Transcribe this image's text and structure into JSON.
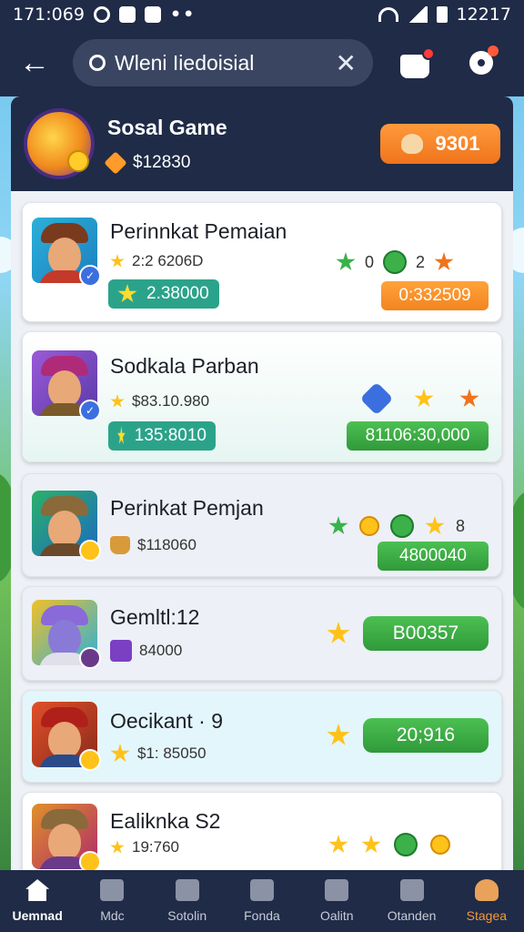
{
  "status_bar": {
    "time": "171:069",
    "right_text": "12217"
  },
  "top_bar": {
    "search_placeholder": "Wleni Iiedoisial",
    "clear_glyph": "✕",
    "back_glyph": "←"
  },
  "header": {
    "title": "Sosal Game",
    "balance": "$12830",
    "button_label": "9301"
  },
  "cards": [
    {
      "title": "Perinnkat Pemaian",
      "sub": "2:2 6206D",
      "pill": "2.38000",
      "right_icons_text_a": "0",
      "right_icons_text_b": "2",
      "right_button": "0:332509"
    },
    {
      "title": "Sodkala Parban",
      "sub": "$83.10.980",
      "pill": "135:8010",
      "right_button": "81106:30,000"
    },
    {
      "title": "Perinkat Pemjan",
      "sub": "$118060",
      "right_icon_text": "8",
      "right_button": "4800040"
    },
    {
      "title": "Gemltl:12",
      "sub": "84000",
      "right_button": "B00357"
    },
    {
      "title": "Oecikant · 9",
      "sub": "$1: 85050",
      "right_button": "20;916"
    },
    {
      "title": "Ealiknka S2",
      "sub": "19:760"
    }
  ],
  "bottom_nav": [
    {
      "label": "Uemnad",
      "icon": "home-icon"
    },
    {
      "label": "Mdc",
      "icon": "feather-icon"
    },
    {
      "label": "Sotolin",
      "icon": "grid-icon"
    },
    {
      "label": "Fonda",
      "icon": "square-icon"
    },
    {
      "label": "Oalitn",
      "icon": "gamepad-icon"
    },
    {
      "label": "Otanden",
      "icon": "search-icon"
    },
    {
      "label": "Stagea",
      "icon": "profile-icon"
    }
  ],
  "colors": {
    "nav_bg": "#1f2b47",
    "accent_orange": "#f38420",
    "accent_green": "#3cae47",
    "accent_teal": "#2ba38a"
  }
}
